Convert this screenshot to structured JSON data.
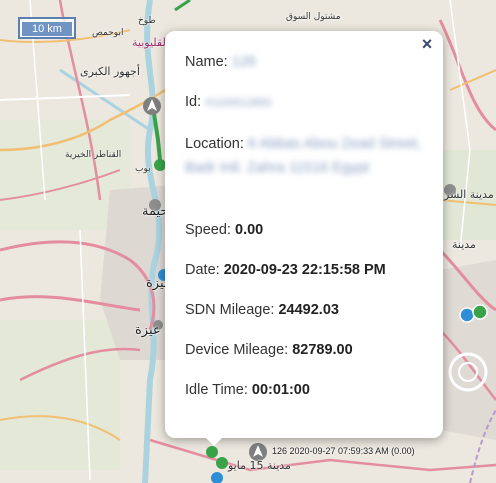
{
  "map": {
    "scale_label": "10 km",
    "place_labels": [
      "طوخ",
      "مشتول السوق",
      "ابوحمص",
      "القليوبية",
      "أجهور الكبرى",
      "القناطر الخيرية",
      "بوب",
      "حيمة",
      "مدينة الشر",
      "مدينة",
      "جيزة",
      "عيزة",
      "مدينة 15 مايو"
    ],
    "track_label": "126 2020-09-27 07:59:33 AM (0.00)"
  },
  "popup": {
    "name_label": "Name:",
    "name_value": "126",
    "id_label": "Id:",
    "id_value": "#1100012850",
    "location_label": "Location:",
    "location_value": "6 Abbas Abou Zead Street, Badr Intl. Zahra 11516 Egypt",
    "speed_label": "Speed:",
    "speed_value": "0.00",
    "date_label": "Date:",
    "date_value": "2020-09-23 22:15:58 PM",
    "sdn_label": "SDN Mileage:",
    "sdn_value": "24492.03",
    "device_label": "Device Mileage:",
    "device_value": "82789.00",
    "idle_label": "Idle Time:",
    "idle_value": "00:01:00",
    "close_icon": "×"
  },
  "colors": {
    "marker_green": "#3aa34a",
    "marker_blue": "#2e8fd6",
    "road_pink": "#e58fa0",
    "road_orange": "#f3c37b",
    "water": "#aad3df"
  }
}
